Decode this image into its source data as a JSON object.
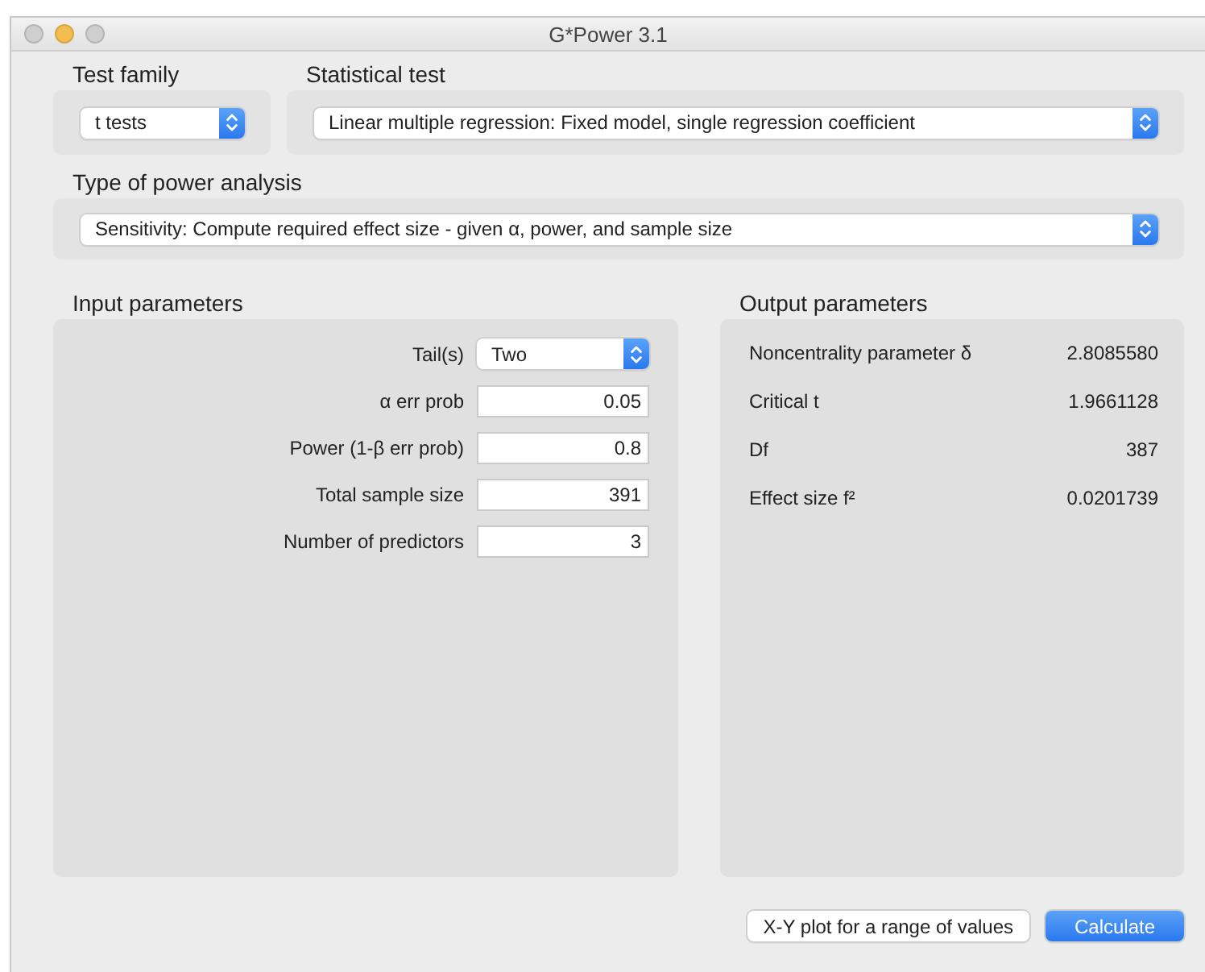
{
  "window": {
    "title": "G*Power 3.1"
  },
  "test_family": {
    "label": "Test family",
    "value": "t tests"
  },
  "statistical_test": {
    "label": "Statistical test",
    "value": "Linear multiple regression: Fixed model, single regression coefficient"
  },
  "power_analysis": {
    "label": "Type of power analysis",
    "value": "Sensitivity: Compute required effect size - given α, power, and sample size"
  },
  "input_parameters": {
    "title": "Input parameters",
    "rows": [
      {
        "kind": "select",
        "label": "Tail(s)",
        "value": "Two"
      },
      {
        "kind": "field",
        "label": "α err prob",
        "value": "0.05"
      },
      {
        "kind": "field",
        "label": "Power (1-β err prob)",
        "value": "0.8"
      },
      {
        "kind": "field",
        "label": "Total sample size",
        "value": "391"
      },
      {
        "kind": "field",
        "label": "Number of predictors",
        "value": "3"
      }
    ]
  },
  "output_parameters": {
    "title": "Output parameters",
    "rows": [
      {
        "label": "Noncentrality parameter δ",
        "value": "2.8085580"
      },
      {
        "label": "Critical t",
        "value": "1.9661128"
      },
      {
        "label": "Df",
        "value": "387"
      },
      {
        "label": "Effect size f²",
        "value": "0.0201739"
      }
    ]
  },
  "buttons": [
    {
      "kind": "plain",
      "label": "X-Y plot for a range of values"
    },
    {
      "kind": "primary",
      "label": "Calculate"
    }
  ]
}
